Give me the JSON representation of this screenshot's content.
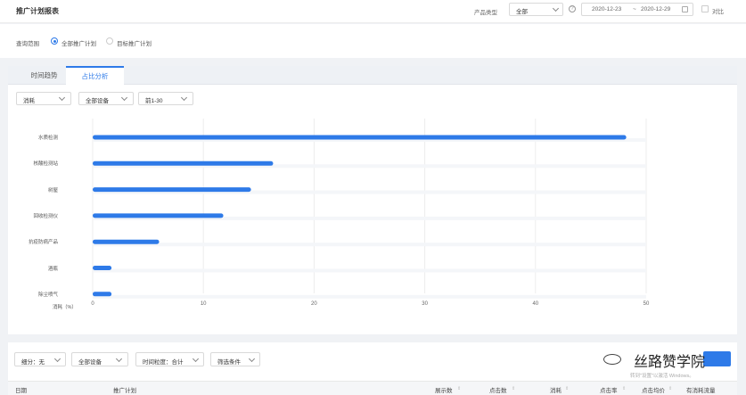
{
  "header": {
    "title": "推广计划报表",
    "product_type_label": "产品类型",
    "product_type_value": "全部",
    "help_glyph": "?",
    "date_start": "2020-12-23",
    "date_sep": "~",
    "date_end": "2020-12-29",
    "compare_label": "对比"
  },
  "scope": {
    "label": "查询范围",
    "options": [
      {
        "label": "全部推广计划",
        "selected": true
      },
      {
        "label": "目标推广计划",
        "selected": false
      }
    ]
  },
  "tabs": [
    {
      "label": "时间趋势",
      "active": false
    },
    {
      "label": "占比分析",
      "active": true
    }
  ],
  "chart_filters": {
    "metric": "消耗",
    "device": "全部设备",
    "range": "前1-30"
  },
  "chart_data": {
    "type": "bar",
    "orientation": "horizontal",
    "categories": [
      "水质检测",
      "核酸检测站",
      "树屋",
      "回收检测仪",
      "抗疫防病产品",
      "酒瓶",
      "除尘喷气"
    ],
    "values": [
      48.2,
      16.3,
      14.3,
      11.8,
      6.0,
      1.7,
      1.7
    ],
    "xlim": [
      0,
      50
    ],
    "xticks": [
      0,
      10,
      20,
      30,
      40,
      50
    ],
    "xlabel": "消耗（%）",
    "grid": true,
    "bar_color": "#2e7ae8"
  },
  "table": {
    "filters": {
      "breakdown": "细分：无",
      "device": "全部设备",
      "granularity": "时间粒度：合计",
      "conditions": "筛选条件"
    },
    "columns": [
      "日期",
      "推广计划",
      "展示数",
      "点击数",
      "消耗",
      "点击率",
      "点击均价",
      "有消耗流量"
    ],
    "sort_glyph": "⇕"
  },
  "overlay": {
    "watermark": "丝路赞学院",
    "activate_text": "转到\"设置\"以激活 Windows。"
  }
}
